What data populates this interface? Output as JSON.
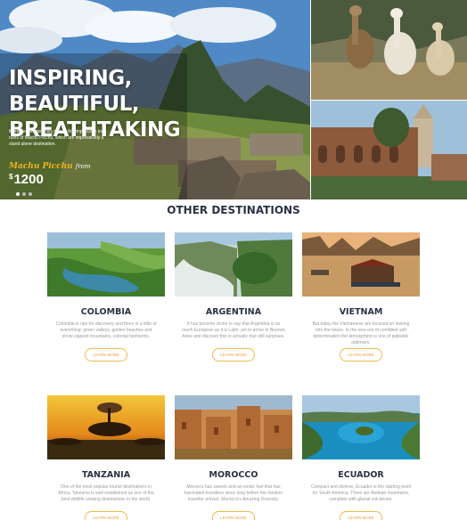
{
  "hero": {
    "title_line1": "INSPIRING, BEAUTIFUL,",
    "title_line2": "BREATHTAKING",
    "description": "More people visit Peru to see the impressive Inca ruins of Machu Picchu, which are impressively a stand alone destination.",
    "price_label": "Machu Picchu",
    "price_from": "from",
    "price_currency": "$",
    "price_value": "1200",
    "slides": 3
  },
  "section": {
    "title": "OTHER DESTINATIONS"
  },
  "destinations": [
    {
      "name": "COLOMBIA",
      "description": "Colombia is ripe for discovery and there is a little of everything: green valleys, golden beaches and snow-capped mountains, colonial heirlooms.",
      "button": "LEARN MORE"
    },
    {
      "name": "ARGENTINA",
      "description": "It has become cliche to say that Argentina is as much European as it is Latin, yet to arrive in Buenos Aires and discover this is actually true still surprises.",
      "button": "LEARN MORE"
    },
    {
      "name": "VIETNAM",
      "description": "But today the Vietnamese are focused on looking into the future. In the new era of confident self determination the atmosphere is one of palpable optimism.",
      "button": "LEARN MORE"
    },
    {
      "name": "TANZANIA",
      "description": "One of the most popular tourist destinations in Africa, Tanzania is well established as one of the best wildlife viewing destinations in the world.",
      "button": "LEARN MORE"
    },
    {
      "name": "MOROCCO",
      "description": "Morocco has sweets and an exotic feel that has fascinated travellers since long before the modern traveller arrived. Morocco's Amazing Diversity.",
      "button": "LEARN MORE"
    },
    {
      "name": "ECUADOR",
      "description": "Compact and diverse, Ecuador is the starting point for South America. There are Andean mountains, complete with glacial volcanoes.",
      "button": "LEARN MORE"
    }
  ]
}
